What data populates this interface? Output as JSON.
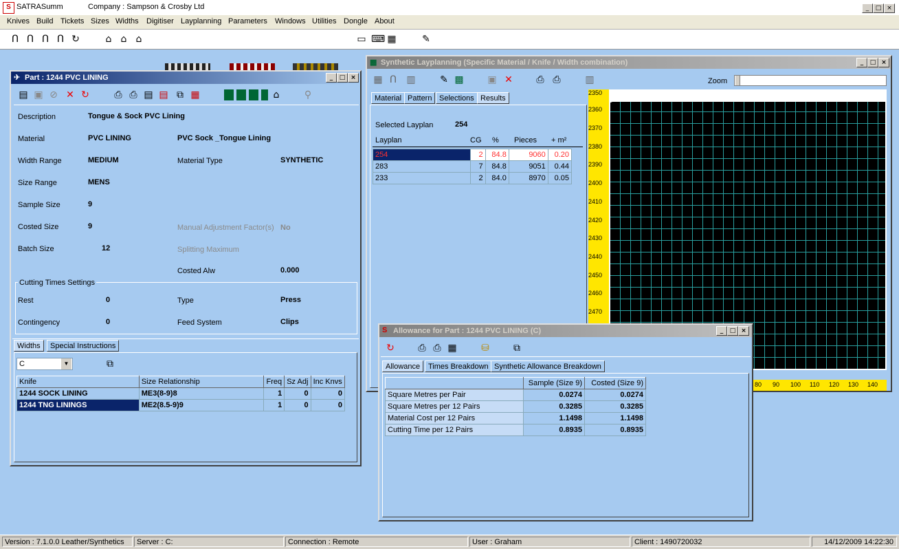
{
  "app": {
    "title": "SATRASumm",
    "company": "Company : Sampson & Crosby Ltd"
  },
  "menu": [
    "Knives",
    "Build",
    "Tickets",
    "Sizes",
    "Widths",
    "Digitiser",
    "Layplanning",
    "Parameters",
    "Windows",
    "Utilities",
    "Dongle",
    "About"
  ],
  "part_window": {
    "title": "Part : 1244 PVC LINING",
    "fields": {
      "description_label": "Description",
      "description": "Tongue & Sock PVC Lining",
      "material_label": "Material",
      "material": "PVC LINING",
      "material_desc": "PVC Sock _Tongue Lining",
      "width_range_label": "Width Range",
      "width_range": "MEDIUM",
      "material_type_label": "Material Type",
      "material_type": "SYNTHETIC",
      "size_range_label": "Size Range",
      "size_range": "MENS",
      "sample_size_label": "Sample Size",
      "sample_size": "9",
      "costed_size_label": "Costed Size",
      "costed_size": "9",
      "manual_adj_label": "Manual Adjustment Factor(s)",
      "manual_adj": "No",
      "batch_size_label": "Batch Size",
      "batch_size": "12",
      "splitting_label": "Splitting Maximum",
      "costed_alw_label": "Costed Alw",
      "costed_alw": "0.000"
    },
    "cutting": {
      "group_label": "Cutting Times Settings",
      "rest_label": "Rest",
      "rest": "0",
      "type_label": "Type",
      "type": "Press",
      "contingency_label": "Contingency",
      "contingency": "0",
      "feed_label": "Feed System",
      "feed": "Clips"
    },
    "tabs": [
      "Widths",
      "Special Instructions"
    ],
    "width_select": "C",
    "knife_table": {
      "headers": [
        "Knife",
        "Size Relationship",
        "Freq",
        "Sz Adj",
        "Inc Knvs"
      ],
      "rows": [
        [
          "1244 SOCK LINING",
          "ME3(8-9)8",
          "1",
          "0",
          "0"
        ],
        [
          "1244 TNG LININGS",
          "ME2(8.5-9)9",
          "1",
          "0",
          "0"
        ]
      ]
    }
  },
  "layplan_window": {
    "title": "Synthetic Layplanning (Specific Material / Knife / Width combination)",
    "zoom_label": "Zoom",
    "tabs": [
      "Material",
      "Pattern",
      "Selections",
      "Results"
    ],
    "selected_label": "Selected Layplan",
    "selected": "254",
    "table": {
      "headers": [
        "Layplan",
        "CG",
        "%",
        "Pieces",
        "+ m²"
      ],
      "rows": [
        [
          "254",
          "2",
          "84.8",
          "9060",
          "0.20"
        ],
        [
          "283",
          "7",
          "84.8",
          "9051",
          "0.44"
        ],
        [
          "233",
          "2",
          "84.0",
          "8970",
          "0.05"
        ]
      ]
    },
    "ruler_y": [
      "2350",
      "2360",
      "2370",
      "2380",
      "2390",
      "2400",
      "2410",
      "2420",
      "2430",
      "2440",
      "2450",
      "2460",
      "2470"
    ],
    "ruler_x": [
      "80",
      "90",
      "100",
      "110",
      "120",
      "130",
      "140"
    ]
  },
  "allowance_window": {
    "title": "Allowance for Part : 1244 PVC LINING (C)",
    "tabs": [
      "Allowance",
      "Times Breakdown",
      "Synthetic Allowance Breakdown"
    ],
    "table": {
      "headers": [
        "",
        "Sample (Size 9)",
        "Costed (Size 9)"
      ],
      "rows": [
        [
          "Square Metres per Pair",
          "0.0274",
          "0.0274"
        ],
        [
          "Square Metres per 12 Pairs",
          "0.3285",
          "0.3285"
        ],
        [
          "Material Cost per 12 Pairs",
          "1.1498",
          "1.1498"
        ],
        [
          "Cutting Time per 12 Pairs",
          "0.8935",
          "0.8935"
        ]
      ]
    }
  },
  "status": {
    "version": "Version : 7.1.0.0 Leather/Synthetics",
    "server": "Server : C:",
    "connection": "Connection : Remote",
    "user": "User : Graham",
    "client": "Client : 1490720032",
    "datetime": "14/12/2009 14:22:30"
  }
}
